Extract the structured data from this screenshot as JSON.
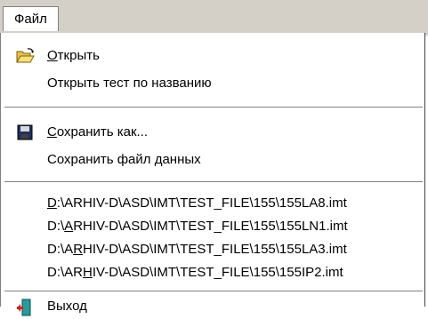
{
  "menu": {
    "title": "Файл",
    "groups": [
      {
        "items": [
          {
            "accel": "О",
            "rest": "ткрыть",
            "icon": "open-folder-icon"
          },
          {
            "label": "Открыть тест по названию"
          }
        ]
      },
      {
        "items": [
          {
            "accel": "С",
            "rest": "охранить как...",
            "icon": "save-disk-icon"
          },
          {
            "label": "Сохранить файл данных"
          }
        ]
      },
      {
        "recent": [
          {
            "pre": "",
            "accel": "D",
            "post": ":\\ARHIV-D\\ASD\\IMT\\TEST_FILE\\155\\155LA8.imt"
          },
          {
            "pre": "D:\\",
            "accel": "A",
            "post": "RHIV-D\\ASD\\IMT\\TEST_FILE\\155\\155LN1.imt"
          },
          {
            "pre": "D:\\A",
            "accel": "R",
            "post": "HIV-D\\ASD\\IMT\\TEST_FILE\\155\\155LA3.imt"
          },
          {
            "pre": "D:\\AR",
            "accel": "H",
            "post": "IV-D\\ASD\\IMT\\TEST_FILE\\155\\155IP2.imt"
          }
        ]
      },
      {
        "items": [
          {
            "label": "Выход",
            "icon": "exit-door-icon"
          }
        ]
      }
    ]
  },
  "colors": {
    "menubar": "#d4d0c8",
    "dropdown": "#ffffff",
    "separator": "#808080"
  }
}
